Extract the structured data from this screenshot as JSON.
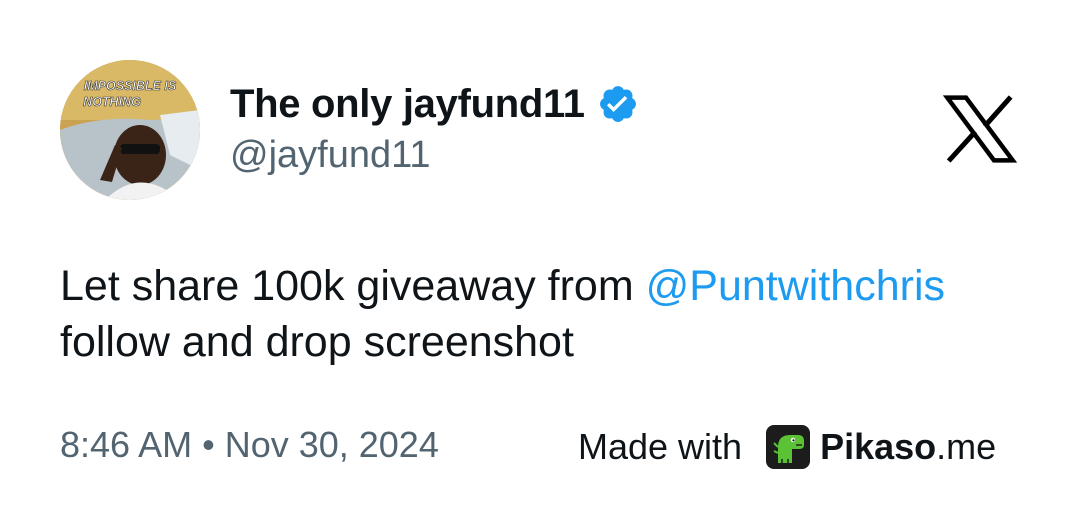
{
  "tweet": {
    "display_name": "The only jayfund11",
    "handle": "@jayfund11",
    "text_line1": "Let share 100k giveaway from",
    "mention": "@Puntwithchris",
    "text_line2": "follow and drop screenshot",
    "timestamp": "8:46 AM • Nov 30, 2024",
    "verified": true
  },
  "avatar": {
    "banner_line1": "IMPOSSIBLE IS",
    "banner_line2": "NOTHING"
  },
  "footer": {
    "made_with_label": "Made with",
    "brand_name": "Pikaso",
    "brand_tld": ".me"
  },
  "icons": {
    "verified": "verified-badge-icon",
    "platform_logo": "x-logo-icon",
    "brand_logo": "pikaso-dino-icon"
  },
  "colors": {
    "verified_blue": "#1d9bf0",
    "mention_blue": "#1d9bf0",
    "muted_text": "#536471",
    "primary_text": "#0f1419",
    "pikaso_green": "#5bc236"
  }
}
